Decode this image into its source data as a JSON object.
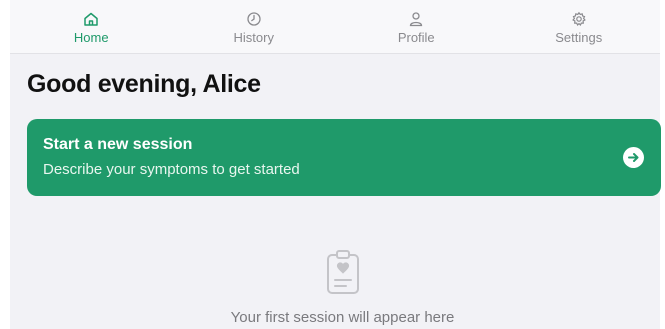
{
  "tabs": [
    {
      "label": "Home",
      "icon": "home-icon",
      "active": true
    },
    {
      "label": "History",
      "icon": "clock-icon",
      "active": false
    },
    {
      "label": "Profile",
      "icon": "person-icon",
      "active": false
    },
    {
      "label": "Settings",
      "icon": "gear-icon",
      "active": false
    }
  ],
  "greeting": "Good evening, Alice",
  "session_card": {
    "title": "Start a new session",
    "subtitle": "Describe your symptoms to get started",
    "icon": "arrow-right-circle-icon"
  },
  "empty_state": {
    "icon": "clipboard-heart-icon",
    "text": "Your first session will appear here"
  },
  "colors": {
    "accent": "#1f9a6a",
    "background": "#f2f2f6",
    "inactive_tab": "#8a8a8e"
  }
}
